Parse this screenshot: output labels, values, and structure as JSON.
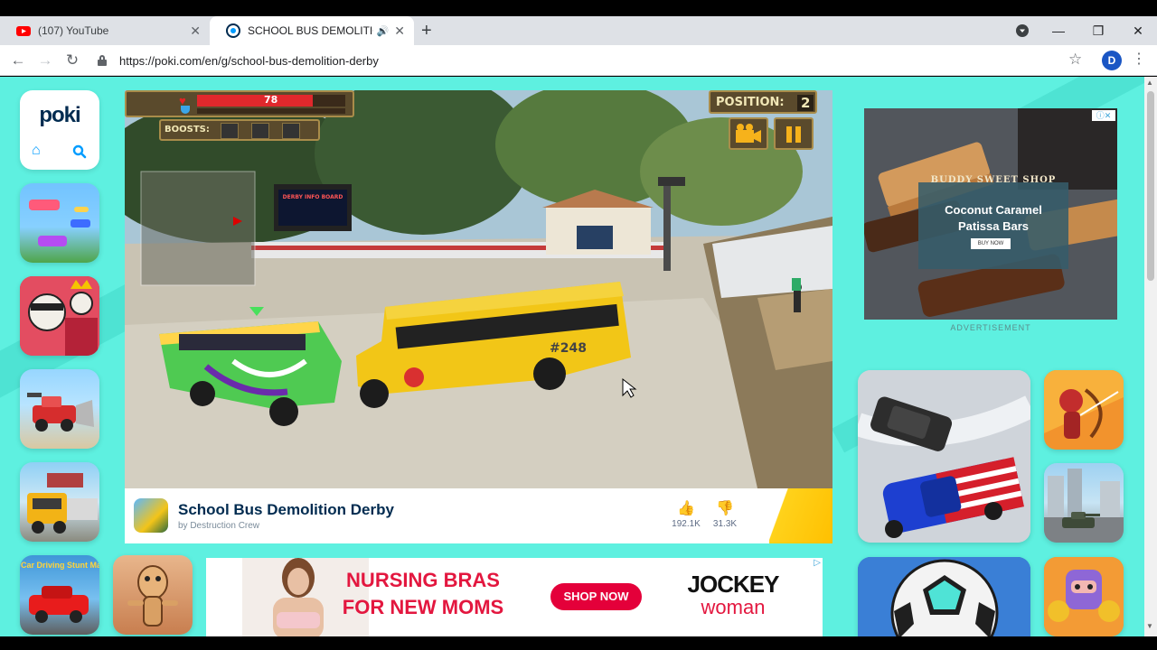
{
  "browser": {
    "tabs": [
      {
        "title": "(107) YouTube",
        "icon": "youtube-icon",
        "active": false
      },
      {
        "title": "SCHOOL BUS DEMOLITION",
        "icon": "poki-icon",
        "active": true
      }
    ],
    "url": "https://poki.com/en/g/school-bus-demolition-derby",
    "profile_initial": "D"
  },
  "site": {
    "logo": "poki"
  },
  "game": {
    "hud": {
      "health_value": "78",
      "health_fraction": 0.78,
      "boosts_label": "BOOSTS:",
      "position_label": "POSITION:",
      "position_value": "2",
      "screen_text": "DERBY INFO BOARD",
      "bus_number": "#248"
    },
    "title": "School Bus Demolition Derby",
    "developer": "by Destruction Crew",
    "likes": "192.1K",
    "dislikes": "31.3K"
  },
  "ads": {
    "top": {
      "brand": "BUDDY SWEET SHOP",
      "headline": "Coconut Caramel Patissa Bars",
      "cta": "BUY NOW",
      "label": "ADVERTISEMENT"
    },
    "bottom": {
      "headline_line1": "NURSING BRAS",
      "headline_line2": "FOR NEW MOMS",
      "cta": "SHOP NOW",
      "brand_line1": "JOCKEY",
      "brand_line2": "woman"
    }
  },
  "tiles": {
    "city_car_driving": "City Car Driving Stunt Master"
  },
  "colors": {
    "page_bg": "#5ef0e0",
    "poki_blue": "#009cff",
    "ad_cta_red": "#e4003a"
  }
}
